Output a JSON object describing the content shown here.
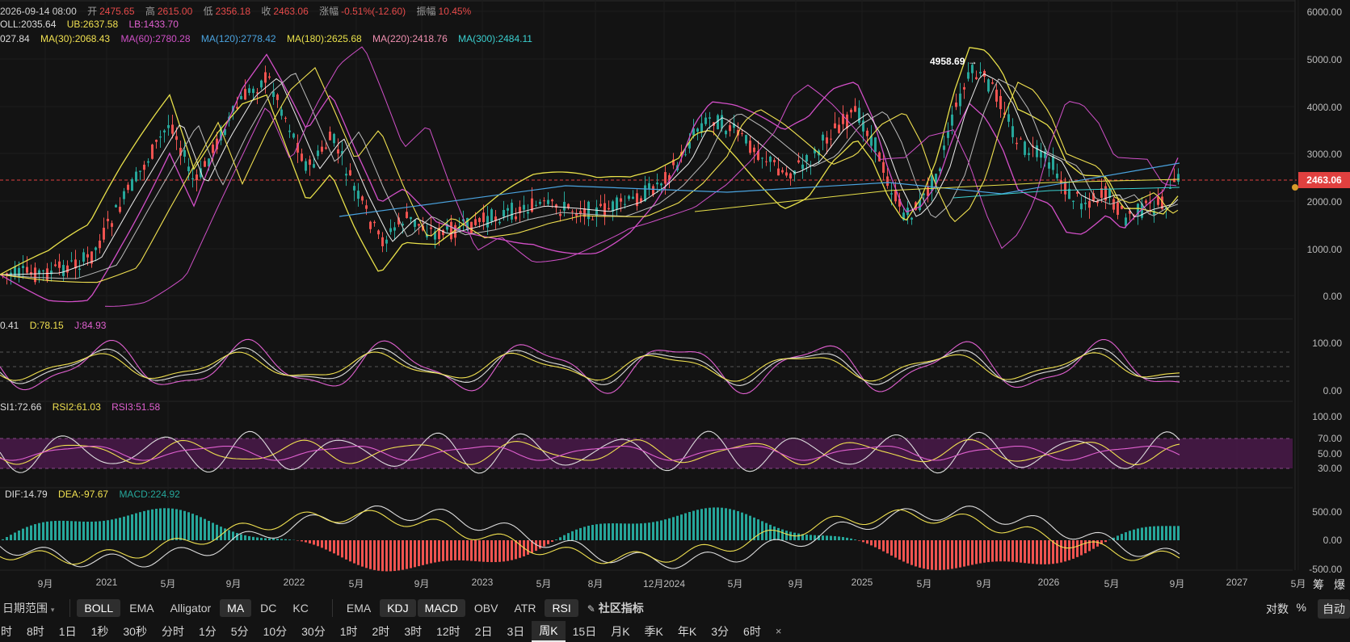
{
  "legend": {
    "ohlc": {
      "datetime": "2026-09-14 08:00",
      "open_label": "开",
      "open": "2475.65",
      "high_label": "高",
      "high": "2615.00",
      "low_label": "低",
      "low": "2356.18",
      "close_label": "收",
      "close": "2463.06",
      "change_label": "涨幅",
      "change": "-0.51%(-12.60)",
      "amplitude_label": "振幅",
      "amplitude": "10.45%"
    },
    "boll": {
      "mid": "OLL:2035.64",
      "ub": "UB:2637.58",
      "lb": "LB:1433.70"
    },
    "ma": {
      "ma_short": "027.84",
      "ma30": "MA(30):2068.43",
      "ma60": "MA(60):2780.28",
      "ma120": "MA(120):2778.42",
      "ma180": "MA(180):2625.68",
      "ma220": "MA(220):2418.76",
      "ma300": "MA(300):2484.11"
    },
    "kdj": {
      "k": "0.41",
      "d": "D:78.15",
      "j": "J:84.93"
    },
    "rsi": {
      "rsi1": "SI1:72.66",
      "rsi2": "RSI2:61.03",
      "rsi3": "RSI3:51.58"
    },
    "macd": {
      "dif": "DIF:14.79",
      "dea": "DEA:-97.67",
      "macd": "MACD:224.92"
    }
  },
  "price_axis": [
    "6000.00",
    "5000.00",
    "4000.00",
    "3000.00",
    "2000.00",
    "1000.00",
    "0.00"
  ],
  "kdj_axis": [
    "100.00",
    "0.00"
  ],
  "rsi_axis": [
    "100.00",
    "70.00",
    "50.00",
    "30.00"
  ],
  "macd_axis": [
    "500.00",
    "0.00",
    "-500.00"
  ],
  "current_price": "2463.06",
  "peak_annotation": "4958.69 →",
  "x_axis": [
    "9月",
    "2021",
    "5月",
    "9月",
    "2022",
    "5月",
    "9月",
    "2023",
    "5月",
    "8月",
    "12月2024",
    "5月",
    "9月",
    "2025",
    "5月",
    "9月",
    "2026",
    "5月",
    "9月",
    "2027",
    "5月"
  ],
  "toolbar": {
    "period_range": "日期范围",
    "main_indicators": [
      "BOLL",
      "EMA",
      "Alligator",
      "MA",
      "DC",
      "KC"
    ],
    "main_active": [
      "BOLL",
      "MA"
    ],
    "sub_indicators": [
      "EMA",
      "KDJ",
      "MACD",
      "OBV",
      "ATR",
      "RSI"
    ],
    "sub_active": [
      "KDJ",
      "MACD",
      "RSI"
    ],
    "community": "社区指标",
    "right": {
      "log": "对数",
      "percent": "%",
      "auto": "自动"
    }
  },
  "intervals": [
    "时",
    "8时",
    "1日",
    "1秒",
    "30秒",
    "分时",
    "1分",
    "5分",
    "10分",
    "30分",
    "1时",
    "2时",
    "3时",
    "12时",
    "2日",
    "3日",
    "周K",
    "15日",
    "月K",
    "季K",
    "年K",
    "3分",
    "6时"
  ],
  "interval_active": "周K",
  "corner": {
    "chip": "筹",
    "burst": "爆"
  },
  "colors": {
    "up": "#26a69a",
    "down": "#ef5350",
    "boll_up": "#e8e04a",
    "boll_low": "#d34fc8",
    "ma_white": "#dddddd",
    "ma120": "#4aa3df",
    "rsi_band": "#4a1a4a"
  }
}
